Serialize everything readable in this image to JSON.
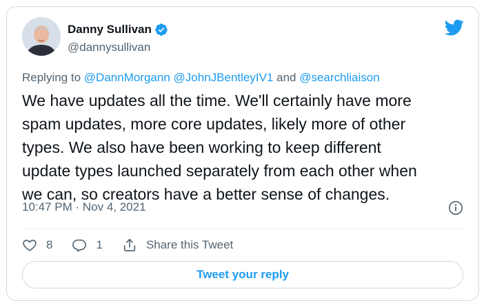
{
  "author": {
    "display_name": "Danny Sullivan",
    "handle": "@dannysullivan",
    "verified": true
  },
  "reply_context": {
    "prefix": "Replying to",
    "mentions": [
      "@DannMorgann",
      "@JohnJBentleyIV1",
      "@searchliaison"
    ],
    "joiner": "and"
  },
  "tweet": {
    "text_lines": [
      "We have updates all the time. We'll certainly have more",
      "spam updates, more core updates, likely more of other",
      "types. We also have been working to keep different",
      "update types launched separately from each other when",
      "we can, so creators have a better sense of changes."
    ],
    "timestamp": "10:47 PM · Nov 4, 2021"
  },
  "actions": {
    "like_count": "8",
    "reply_count": "1",
    "share_label": "Share this Tweet"
  },
  "reply_button": {
    "label": "Tweet your reply"
  },
  "colors": {
    "accent": "#1d9bf0",
    "text": "#0f1419",
    "secondary": "#536471",
    "border": "#cfd9de"
  },
  "icons": [
    "twitter-bird-icon",
    "verified-badge-icon",
    "info-icon",
    "heart-icon",
    "reply-icon",
    "share-icon"
  ]
}
